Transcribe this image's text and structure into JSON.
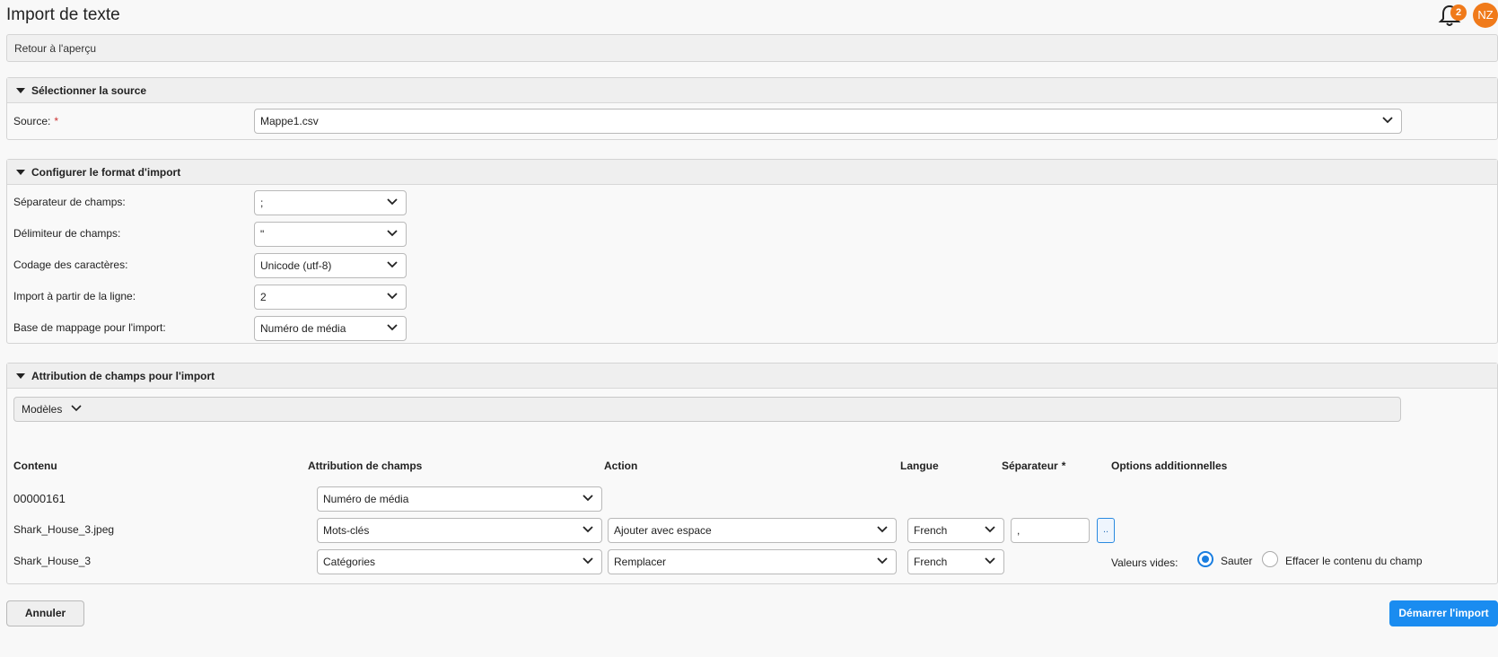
{
  "header": {
    "title": "Import de texte",
    "notification_count": "2",
    "avatar_initials": "NZ"
  },
  "back_link": "Retour à l'aperçu",
  "source_section": {
    "title": "Sélectionner la source",
    "source_label": "Source:",
    "required_mark": "*",
    "source_value": "Mappe1.csv"
  },
  "format_section": {
    "title": "Configurer le format d'import",
    "fields": [
      {
        "label": "Séparateur de champs:",
        "value": ";"
      },
      {
        "label": "Délimiteur de champs:",
        "value": "\""
      },
      {
        "label": "Codage des caractères:",
        "value": "Unicode (utf-8)"
      },
      {
        "label": "Import à partir de la ligne:",
        "value": "2"
      },
      {
        "label": "Base de mappage pour l'import:",
        "value": "Numéro de média"
      }
    ]
  },
  "mapping_section": {
    "title": "Attribution de champs pour l'import",
    "models_label": "Modèles",
    "columns": {
      "content": "Contenu",
      "field": "Attribution de champs",
      "action": "Action",
      "language": "Langue",
      "separator": "Séparateur",
      "separator_required": "*",
      "options": "Options additionnelles"
    },
    "rows": [
      {
        "content": "00000161",
        "field": "Numéro de média"
      },
      {
        "content": "Shark_House_3.jpeg",
        "field": "Mots-clés",
        "action": "Ajouter avec espace",
        "language": "French",
        "separator": ",",
        "more_button": ".."
      },
      {
        "content": "Shark_House_3",
        "field": "Catégories",
        "action": "Remplacer",
        "language": "French"
      }
    ],
    "empty_values": {
      "label": "Valeurs vides:",
      "option_skip": "Sauter",
      "option_clear": "Effacer le contenu du champ",
      "selected": "Sauter"
    }
  },
  "footer": {
    "cancel_label": "Annuler",
    "start_label": "Démarrer l'import"
  },
  "colors": {
    "accent": "#1a8cf0",
    "badge": "#f07a1a"
  }
}
